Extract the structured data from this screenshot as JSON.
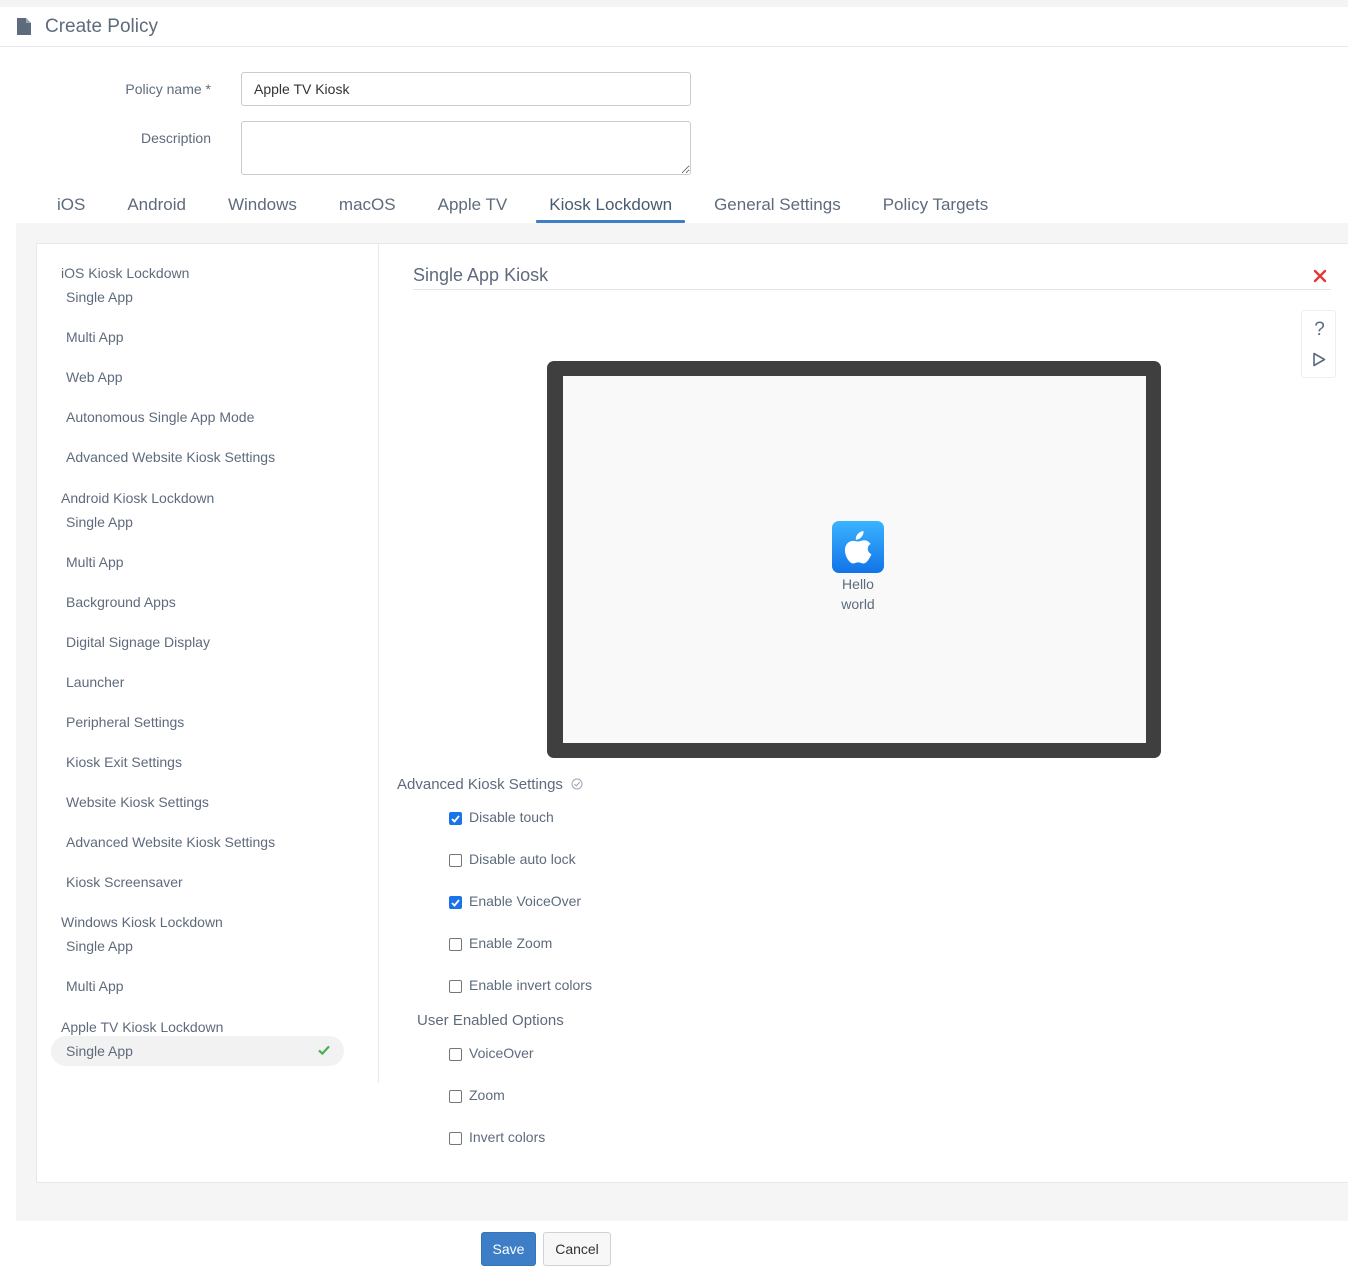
{
  "header": {
    "title": "Create Policy",
    "icon": "document-icon"
  },
  "form": {
    "policy_name_label": "Policy name",
    "required_marker": "*",
    "policy_name_value": "Apple TV Kiosk",
    "description_label": "Description",
    "description_value": ""
  },
  "tabs": [
    {
      "label": "iOS"
    },
    {
      "label": "Android"
    },
    {
      "label": "Windows"
    },
    {
      "label": "macOS"
    },
    {
      "label": "Apple TV"
    },
    {
      "label": "Kiosk Lockdown",
      "active": true
    },
    {
      "label": "General Settings"
    },
    {
      "label": "Policy Targets"
    }
  ],
  "sidebar": {
    "groups": [
      {
        "label": "iOS Kiosk Lockdown",
        "items": [
          "Single App",
          "Multi App",
          "Web App",
          "Autonomous Single App Mode",
          "Advanced Website Kiosk Settings"
        ]
      },
      {
        "label": "Android Kiosk Lockdown",
        "items": [
          "Single App",
          "Multi App",
          "Background Apps",
          "Digital Signage Display",
          "Launcher",
          "Peripheral Settings",
          "Kiosk Exit Settings",
          "Website Kiosk Settings",
          "Advanced Website Kiosk Settings",
          "Kiosk Screensaver"
        ]
      },
      {
        "label": "Windows Kiosk Lockdown",
        "items": [
          "Single App",
          "Multi App"
        ]
      },
      {
        "label": "Apple TV Kiosk Lockdown",
        "items": [
          "Single App"
        ]
      }
    ],
    "selected": "Apple TV Kiosk Lockdown / Single App",
    "selected_check_color": "#4caf50"
  },
  "panel": {
    "title": "Single App Kiosk",
    "close_icon": "close-icon",
    "help_label": "?",
    "play_icon": "play-icon",
    "app": {
      "name_line1": "Hello",
      "name_line2": "world",
      "icon": "apple-logo-icon"
    }
  },
  "advanced": {
    "title": "Advanced Kiosk Settings",
    "options": [
      {
        "label": "Disable touch",
        "checked": true
      },
      {
        "label": "Disable auto lock",
        "checked": false
      },
      {
        "label": "Enable VoiceOver",
        "checked": true
      },
      {
        "label": "Enable Zoom",
        "checked": false
      },
      {
        "label": "Enable invert colors",
        "checked": false
      }
    ]
  },
  "user_options": {
    "title": "User Enabled Options",
    "options": [
      {
        "label": "VoiceOver",
        "checked": false
      },
      {
        "label": "Zoom",
        "checked": false
      },
      {
        "label": "Invert colors",
        "checked": false
      }
    ]
  },
  "buttons": {
    "save": "Save",
    "cancel": "Cancel"
  },
  "colors": {
    "accent": "#3d7ec6",
    "close": "#e53935",
    "checkbox_checked": "#1a73e8",
    "text": "#5e6b7d"
  }
}
